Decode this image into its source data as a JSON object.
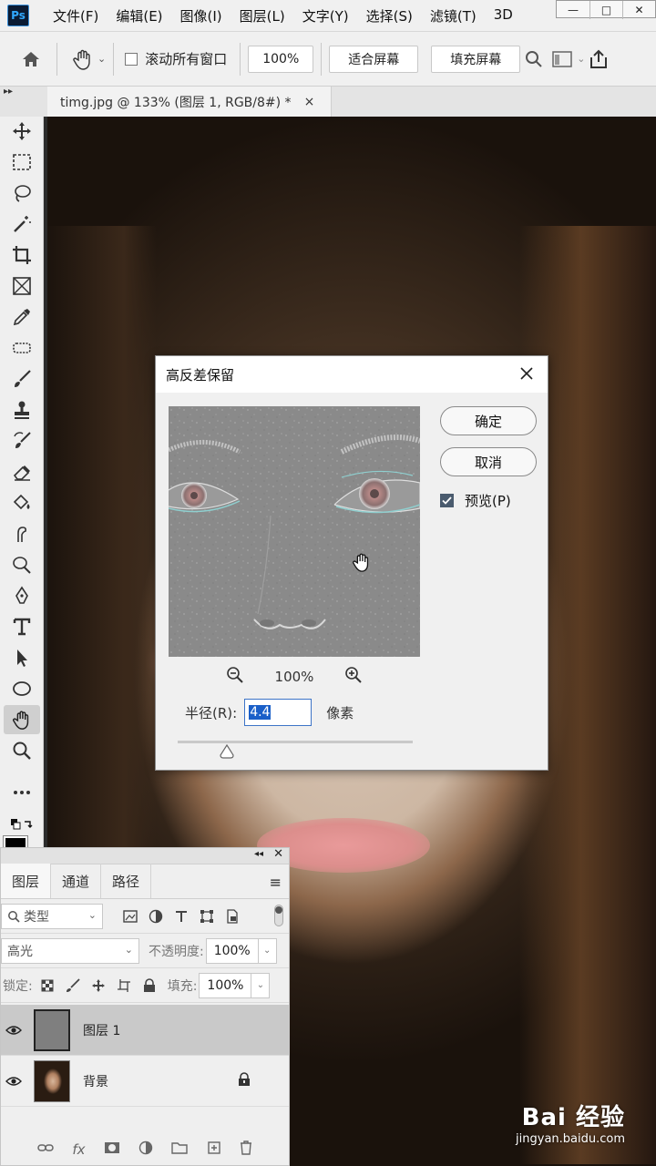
{
  "menubar": {
    "logo": "Ps",
    "items": [
      "文件(F)",
      "编辑(E)",
      "图像(I)",
      "图层(L)",
      "文字(Y)",
      "选择(S)",
      "滤镜(T)",
      "3D"
    ],
    "window_controls": [
      "—",
      "□",
      "✕"
    ]
  },
  "optionsbar": {
    "scroll_all_label": "滚动所有窗口",
    "zoom_value": "100%",
    "fit_screen_label": "适合屏幕",
    "fill_screen_label": "填充屏幕"
  },
  "document_tab": {
    "title": "timg.jpg @ 133% (图层 1, RGB/8#) *",
    "close": "×"
  },
  "dialog": {
    "title": "高反差保留",
    "ok_label": "确定",
    "cancel_label": "取消",
    "preview_label": "预览(P)",
    "preview_checked": true,
    "zoom_level": "100%",
    "radius_label": "半径(R):",
    "radius_value": "4.4",
    "radius_unit": "像素",
    "slider_level": 0.21
  },
  "layers_panel": {
    "tabs": [
      "图层",
      "通道",
      "路径"
    ],
    "filter_kind": "类型",
    "blend_mode": "高光",
    "opacity_label": "不透明度:",
    "opacity_value": "100%",
    "lock_label": "锁定:",
    "fill_label": "填充:",
    "fill_value": "100%",
    "layers": [
      {
        "name": "图层 1",
        "selected": true,
        "locked": false
      },
      {
        "name": "背景",
        "selected": false,
        "locked": true
      }
    ]
  },
  "watermark": {
    "brand": "Bai 经验",
    "url": "jingyan.baidu.com"
  }
}
